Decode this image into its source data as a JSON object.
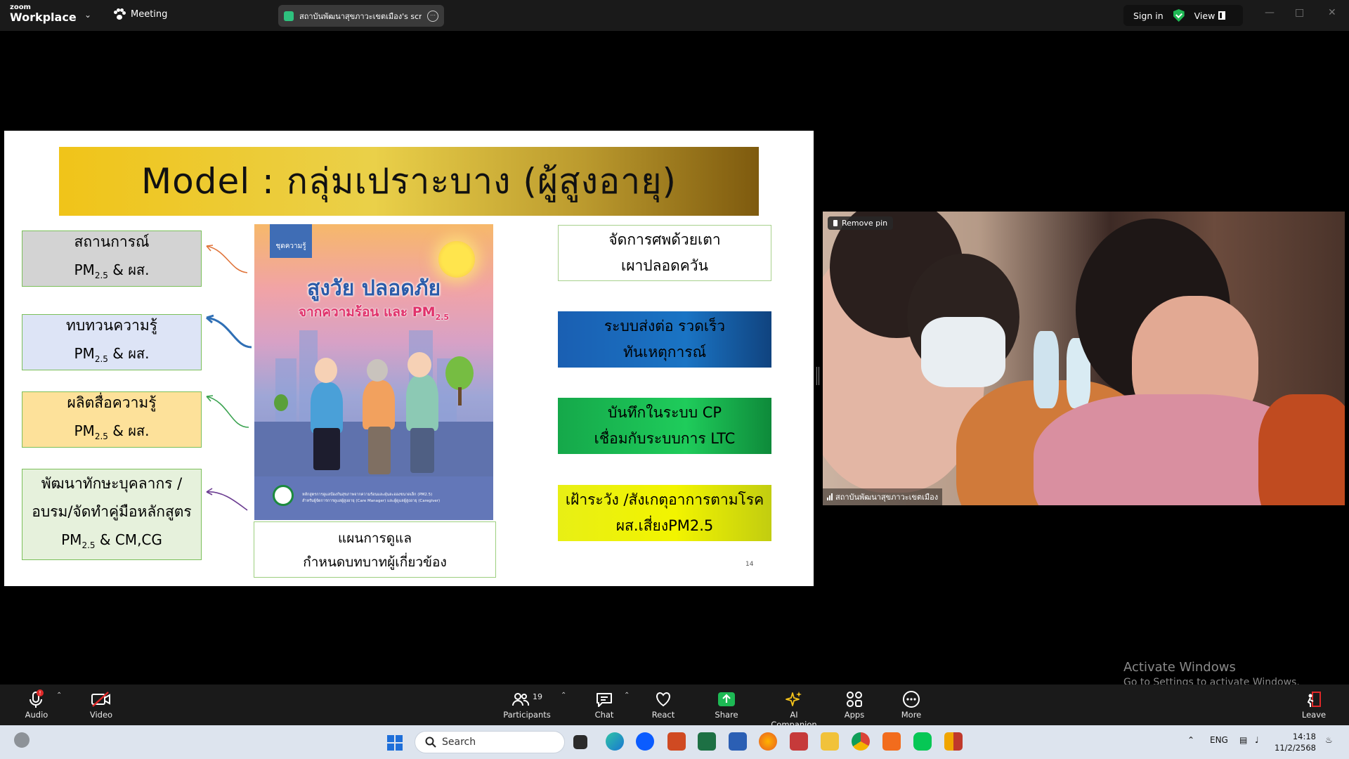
{
  "topbar": {
    "logo_line1": "zoom",
    "logo_line2": "Workplace",
    "meeting_label": "Meeting",
    "share_title": "สถาบันพัฒนาสุขภาวะเขตเมือง's scree",
    "sign_in": "Sign in",
    "view": "View"
  },
  "slide": {
    "title": "Model : กลุ่มเปราะบาง (ผู้สูงอายุ)",
    "left_boxes": [
      {
        "line1": "สถานการณ์",
        "pm": "PM",
        "sub": "2.5",
        "suffix": " & ผส.",
        "bg": "#d3d3d3"
      },
      {
        "line1": "ทบทวนความรู้",
        "pm": "PM",
        "sub": "2.5",
        "suffix": " & ผส.",
        "bg": "#dde4f6"
      },
      {
        "line1": "ผลิตสื่อความรู้",
        "pm": "PM",
        "sub": "2.5",
        "suffix": " & ผส.",
        "bg": "#fde19a"
      },
      {
        "line1": "พัฒนาทักษะบุคลากร /",
        "line2": "อบรม/จัดทำคู่มือหลักสูตร",
        "pm": "PM",
        "sub": "2.5",
        "suffix": " & CM,CG",
        "bg": "#e6f1dc"
      }
    ],
    "right_boxes": [
      {
        "line1": "จัดการศพด้วยเตา",
        "line2": "เผาปลอดควัน"
      },
      {
        "line1": "ระบบส่งต่อ รวดเร็ว",
        "line2": "ทันเหตุการณ์"
      },
      {
        "line1": "บันทึกในระบบ CP",
        "line2": "เชื่อมกับระบบการ LTC"
      },
      {
        "line1": "เฝ้าระวัง /สังเกตุอาการตามโรค",
        "line2": "ผส.เสี่ยงPM2.5"
      }
    ],
    "caption_line1": "แผนการดูแล",
    "caption_line2": "กำหนดบทบาทผู้เกี่ยวข้อง",
    "page_number": "14",
    "poster": {
      "tag": "ชุดความรู้",
      "title": "สูงวัย ปลอดภัย",
      "subtitle": "จากความร้อน และ PM",
      "subtitle_sub": "2.5",
      "fine_line1": "หลักสูตรการดูแลป้องกันสุขภาพจากความร้อนและฝุ่นละอองขนาดเล็ก (PM2.5)",
      "fine_line2": "สำหรับผู้จัดการการดูแลผู้สูงอายุ (Care Manager) และผู้ดูแลผู้สูงอายุ (Caregiver)"
    }
  },
  "video": {
    "remove_pin": "Remove pin",
    "participant_name": "สถาบันพัฒนาสุขภาวะเขตเมือง"
  },
  "watermark": {
    "line1": "Activate Windows",
    "line2": "Go to Settings to activate Windows."
  },
  "toolbar": {
    "audio": "Audio",
    "video": "Video",
    "participants": "Participants",
    "participants_count": "19",
    "chat": "Chat",
    "react": "React",
    "share": "Share",
    "ai_companion": "AI Companion",
    "apps": "Apps",
    "more": "More",
    "leave": "Leave"
  },
  "taskbar": {
    "search_label": "Search",
    "language": "ENG",
    "time": "14:18",
    "date": "11/2/2568"
  },
  "colors": {
    "zoom_bg": "#1a1a1a",
    "share_green": "#1db954",
    "leave_red": "#e02828",
    "taskbar_bg": "#dde4ee"
  }
}
